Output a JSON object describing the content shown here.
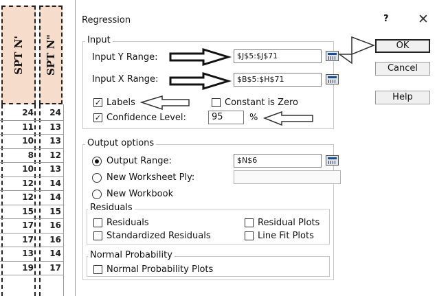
{
  "sheet": {
    "headers": [
      "SPT N'",
      "SPT N\""
    ],
    "rows": [
      [
        "24",
        "24"
      ],
      [
        "11",
        "13"
      ],
      [
        "10",
        "13"
      ],
      [
        "8",
        "12"
      ],
      [
        "10",
        "13"
      ],
      [
        "12",
        "14"
      ],
      [
        "12",
        "14"
      ],
      [
        "15",
        "15"
      ],
      [
        "17",
        "16"
      ],
      [
        "17",
        "16"
      ],
      [
        "13",
        "14"
      ],
      [
        "19",
        "17"
      ]
    ]
  },
  "dialog": {
    "title": "Regression",
    "help_glyph": "?",
    "close_glyph": "✕",
    "input": {
      "group_label": "Input",
      "y_label": "Input Y Range:",
      "y_value": "$J$5:$J$71",
      "x_label": "Input X Range:",
      "x_value": "$B$5:$H$71",
      "labels_label": "Labels",
      "labels_checked": "✓",
      "constant_zero_label": "Constant is Zero",
      "confidence_label": "Confidence Level:",
      "confidence_checked": "✓",
      "confidence_value": "95",
      "percent": "%"
    },
    "output": {
      "group_label": "Output options",
      "output_range_label": "Output Range:",
      "output_range_value": "$N$6",
      "new_ply_label": "New Worksheet Ply:",
      "new_workbook_label": "New Workbook"
    },
    "residuals": {
      "group_label": "Residuals",
      "residuals_label": "Residuals",
      "residual_plots_label": "Residual Plots",
      "standardized_label": "Standardized Residuals",
      "line_fit_label": "Line Fit Plots"
    },
    "normal": {
      "group_label": "Normal Probability",
      "plots_label": "Normal Probability Plots"
    },
    "buttons": {
      "ok": "OK",
      "cancel": "Cancel",
      "help": "Help"
    }
  }
}
